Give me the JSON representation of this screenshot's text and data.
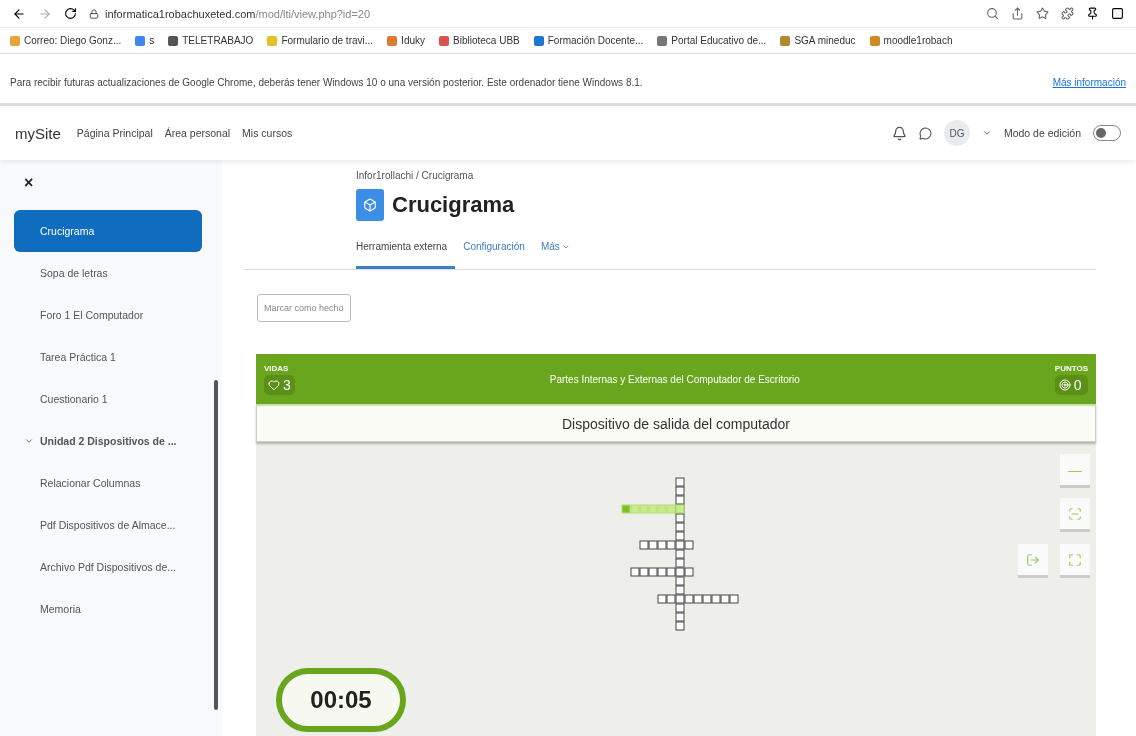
{
  "browser": {
    "url": "informatica1robachuxeted.com/mod/lti/view.php?id=20",
    "bookmarks": [
      {
        "label": "Correo: Diego Gonz...",
        "color": "#e8a33a"
      },
      {
        "label": "s",
        "color": "#4285f4"
      },
      {
        "label": "TELETRABAJO",
        "color": "#555555"
      },
      {
        "label": "Formulario de travi...",
        "color": "#e6c229"
      },
      {
        "label": "Iduky",
        "color": "#e07a2e"
      },
      {
        "label": "Biblioteca UBB",
        "color": "#d9534f"
      },
      {
        "label": "Formación Docente...",
        "color": "#1f77d0"
      },
      {
        "label": "Portal Educativo de...",
        "color": "#777777"
      },
      {
        "label": "SGA mineduc",
        "color": "#b08a2e"
      },
      {
        "label": "moodle1robach",
        "color": "#d08a1e"
      }
    ]
  },
  "infobar": {
    "message": "Para recibir futuras actualizaciones de Google Chrome, deberás tener Windows 10 o una versión posterior. Este ordenador tiene Windows 8.1.",
    "link": "Más información"
  },
  "navbar": {
    "brand": "mySite",
    "links": [
      "Página Principal",
      "Área personal",
      "Mis cursos"
    ],
    "avatar": "DG",
    "edit_mode_label": "Modo de edición",
    "edit_mode_on": false
  },
  "sidebar": {
    "close": "×",
    "items": [
      {
        "label": "Crucigrama",
        "selected": true,
        "kind": "item"
      },
      {
        "label": "Sopa de letras",
        "selected": false,
        "kind": "item"
      },
      {
        "label": "Foro 1 El Computador",
        "selected": false,
        "kind": "item"
      },
      {
        "label": "Tarea Práctica 1",
        "selected": false,
        "kind": "item"
      },
      {
        "label": "Cuestionario 1",
        "selected": false,
        "kind": "item"
      },
      {
        "label": "Unidad 2 Dispositivos de ...",
        "selected": false,
        "kind": "section",
        "expanded": true
      },
      {
        "label": "Relacionar Columnas",
        "selected": false,
        "kind": "item"
      },
      {
        "label": "Pdf Dispositivos de Almace...",
        "selected": false,
        "kind": "item"
      },
      {
        "label": "Archivo Pdf Dispositivos de...",
        "selected": false,
        "kind": "item"
      },
      {
        "label": "Memoria",
        "selected": false,
        "kind": "item"
      }
    ]
  },
  "page": {
    "breadcrumb": "Infor1rollachi / Crucigrama",
    "title": "Crucigrama",
    "tabs": [
      {
        "label": "Herramienta externa",
        "selected": true
      },
      {
        "label": "Configuración",
        "selected": false
      },
      {
        "label": "Más",
        "selected": false
      }
    ],
    "mark_done": "Marcar como hecho"
  },
  "game": {
    "lives_label": "VIDAS",
    "lives": "3",
    "title": "Partes Internas y Externas del Computador de Escritorio",
    "points_label": "PUNTOS",
    "points": "0",
    "clue": "Dispositivo de salida del computador",
    "timer": "00:05",
    "zoom_out": "—"
  }
}
